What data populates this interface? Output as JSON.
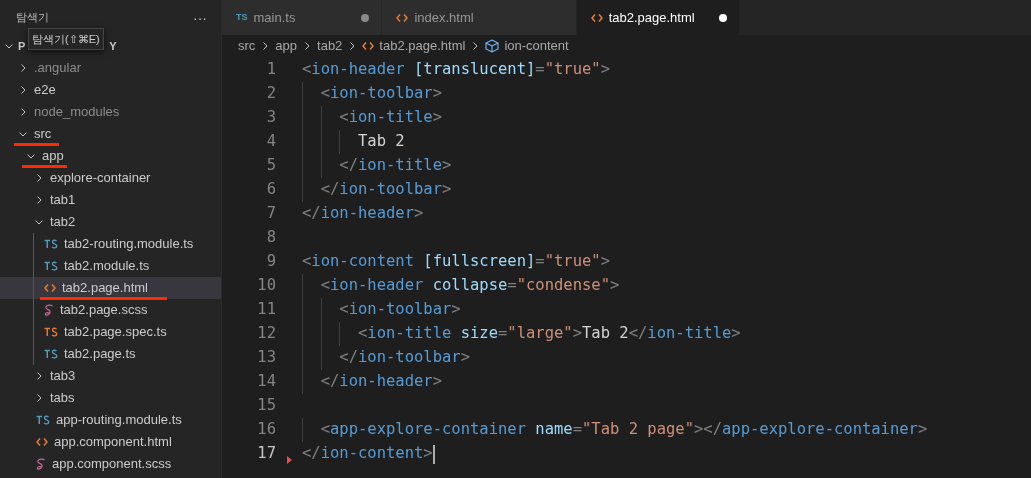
{
  "sidebar": {
    "title": "탐색기",
    "more": "···",
    "tooltip": "탐색기(⇧⌘E)",
    "root": {
      "label_start": "P",
      "label_end": "Y",
      "expanded": true
    },
    "tree": [
      {
        "label": ".angular",
        "kind": "folder",
        "expanded": false,
        "ignored": true,
        "selected": false
      },
      {
        "label": "e2e",
        "kind": "folder",
        "expanded": false,
        "ignored": false,
        "selected": false
      },
      {
        "label": "node_modules",
        "kind": "folder",
        "expanded": false,
        "ignored": true,
        "selected": false
      },
      {
        "label": "src",
        "kind": "folder",
        "expanded": true,
        "ignored": false,
        "selected": false,
        "underlined": true,
        "children": [
          {
            "label": "app",
            "kind": "folder",
            "expanded": true,
            "ignored": false,
            "selected": false,
            "underlined": true,
            "children": [
              {
                "label": "explore-container",
                "kind": "folder",
                "expanded": false,
                "ignored": false,
                "selected": false
              },
              {
                "label": "tab1",
                "kind": "folder",
                "expanded": false,
                "ignored": false,
                "selected": false
              },
              {
                "label": "tab2",
                "kind": "folder",
                "expanded": true,
                "ignored": false,
                "selected": false,
                "children": [
                  {
                    "label": "tab2-routing.module.ts",
                    "kind": "ts",
                    "selected": false
                  },
                  {
                    "label": "tab2.module.ts",
                    "kind": "ts",
                    "selected": false
                  },
                  {
                    "label": "tab2.page.html",
                    "kind": "html",
                    "selected": true,
                    "underlined": true
                  },
                  {
                    "label": "tab2.page.scss",
                    "kind": "scss",
                    "selected": false
                  },
                  {
                    "label": "tab2.page.spec.ts",
                    "kind": "spec",
                    "selected": false
                  },
                  {
                    "label": "tab2.page.ts",
                    "kind": "ts",
                    "selected": false
                  }
                ]
              },
              {
                "label": "tab3",
                "kind": "folder",
                "expanded": false,
                "ignored": false,
                "selected": false
              },
              {
                "label": "tabs",
                "kind": "folder",
                "expanded": false,
                "ignored": false,
                "selected": false
              },
              {
                "label": "app-routing.module.ts",
                "kind": "ts",
                "selected": false
              },
              {
                "label": "app.component.html",
                "kind": "html",
                "selected": false
              },
              {
                "label": "app.component.scss",
                "kind": "scss",
                "selected": false
              }
            ]
          }
        ]
      }
    ]
  },
  "tabs": [
    {
      "label": "main.ts",
      "kind": "ts",
      "badge": "TS",
      "selected": false,
      "modified": true
    },
    {
      "label": "index.html",
      "kind": "html",
      "selected": false,
      "modified": false
    },
    {
      "label": "tab2.page.html",
      "kind": "html",
      "selected": true,
      "modified": true
    }
  ],
  "breadcrumb": [
    {
      "label": "src",
      "kind": "folder"
    },
    {
      "label": "app",
      "kind": "folder"
    },
    {
      "label": "tab2",
      "kind": "folder"
    },
    {
      "label": "tab2.page.html",
      "kind": "html"
    },
    {
      "label": "ion-content",
      "kind": "element"
    }
  ],
  "code": {
    "lines": [
      {
        "number": "1",
        "current": false,
        "tokens": [
          {
            "kind": "punct",
            "text": "<"
          },
          {
            "kind": "tag",
            "text": "ion-header"
          },
          {
            "kind": "attr",
            "text": " [translucent]"
          },
          {
            "kind": "punct",
            "text": "="
          },
          {
            "kind": "string",
            "text": "\"true\""
          },
          {
            "kind": "punct",
            "text": ">"
          }
        ]
      },
      {
        "number": "2",
        "current": false,
        "tokens": [
          {
            "kind": "punct",
            "text": "  <"
          },
          {
            "kind": "tag",
            "text": "ion-toolbar"
          },
          {
            "kind": "punct",
            "text": ">"
          }
        ]
      },
      {
        "number": "3",
        "current": false,
        "tokens": [
          {
            "kind": "punct",
            "text": "    <"
          },
          {
            "kind": "tag",
            "text": "ion-title"
          },
          {
            "kind": "punct",
            "text": ">"
          }
        ]
      },
      {
        "number": "4",
        "current": false,
        "tokens": [
          {
            "kind": "plain",
            "text": "      Tab 2"
          }
        ]
      },
      {
        "number": "5",
        "current": false,
        "tokens": [
          {
            "kind": "punct",
            "text": "    </"
          },
          {
            "kind": "tag",
            "text": "ion-title"
          },
          {
            "kind": "punct",
            "text": ">"
          }
        ]
      },
      {
        "number": "6",
        "current": false,
        "tokens": [
          {
            "kind": "punct",
            "text": "  </"
          },
          {
            "kind": "tag",
            "text": "ion-toolbar"
          },
          {
            "kind": "punct",
            "text": ">"
          }
        ]
      },
      {
        "number": "7",
        "current": false,
        "tokens": [
          {
            "kind": "punct",
            "text": "</"
          },
          {
            "kind": "tag",
            "text": "ion-header"
          },
          {
            "kind": "punct",
            "text": ">"
          }
        ]
      },
      {
        "number": "8",
        "current": false
      },
      {
        "number": "9",
        "current": false,
        "tokens": [
          {
            "kind": "punct",
            "text": "<"
          },
          {
            "kind": "tag",
            "text": "ion-content"
          },
          {
            "kind": "attr",
            "text": " [fullscreen]"
          },
          {
            "kind": "punct",
            "text": "="
          },
          {
            "kind": "string",
            "text": "\"true\""
          },
          {
            "kind": "punct",
            "text": ">"
          }
        ]
      },
      {
        "number": "10",
        "current": false,
        "tokens": [
          {
            "kind": "punct",
            "text": "  <"
          },
          {
            "kind": "tag",
            "text": "ion-header"
          },
          {
            "kind": "attr",
            "text": " collapse"
          },
          {
            "kind": "punct",
            "text": "="
          },
          {
            "kind": "string",
            "text": "\"condense\""
          },
          {
            "kind": "punct",
            "text": ">"
          }
        ]
      },
      {
        "number": "11",
        "current": false,
        "tokens": [
          {
            "kind": "punct",
            "text": "    <"
          },
          {
            "kind": "tag",
            "text": "ion-toolbar"
          },
          {
            "kind": "punct",
            "text": ">"
          }
        ]
      },
      {
        "number": "12",
        "current": false,
        "tokens": [
          {
            "kind": "punct",
            "text": "      <"
          },
          {
            "kind": "tag",
            "text": "ion-title"
          },
          {
            "kind": "attr",
            "text": " size"
          },
          {
            "kind": "punct",
            "text": "="
          },
          {
            "kind": "string",
            "text": "\"large\""
          },
          {
            "kind": "punct",
            "text": ">"
          },
          {
            "kind": "plain",
            "text": "Tab 2"
          },
          {
            "kind": "punct",
            "text": "</"
          },
          {
            "kind": "tag",
            "text": "ion-title"
          },
          {
            "kind": "punct",
            "text": ">"
          }
        ]
      },
      {
        "number": "13",
        "current": false,
        "tokens": [
          {
            "kind": "punct",
            "text": "    </"
          },
          {
            "kind": "tag",
            "text": "ion-toolbar"
          },
          {
            "kind": "punct",
            "text": ">"
          }
        ]
      },
      {
        "number": "14",
        "current": false,
        "tokens": [
          {
            "kind": "punct",
            "text": "  </"
          },
          {
            "kind": "tag",
            "text": "ion-header"
          },
          {
            "kind": "punct",
            "text": ">"
          }
        ]
      },
      {
        "number": "15",
        "current": false
      },
      {
        "number": "16",
        "current": false,
        "tokens": [
          {
            "kind": "punct",
            "text": "  <"
          },
          {
            "kind": "tag",
            "text": "app-explore-container"
          },
          {
            "kind": "attr",
            "text": " name"
          },
          {
            "kind": "punct",
            "text": "="
          },
          {
            "kind": "string",
            "text": "\"Tab 2 page\""
          },
          {
            "kind": "punct",
            "text": ">"
          },
          {
            "kind": "punct",
            "text": "</"
          },
          {
            "kind": "tag",
            "text": "app-explore-container"
          },
          {
            "kind": "punct",
            "text": ">"
          }
        ]
      },
      {
        "number": "17",
        "current": true,
        "deleted_marker": true,
        "tokens": [
          {
            "kind": "punct",
            "text": "</"
          },
          {
            "kind": "tag",
            "text": "ion-content"
          },
          {
            "kind": "punct",
            "text": ">"
          }
        ]
      }
    ]
  }
}
